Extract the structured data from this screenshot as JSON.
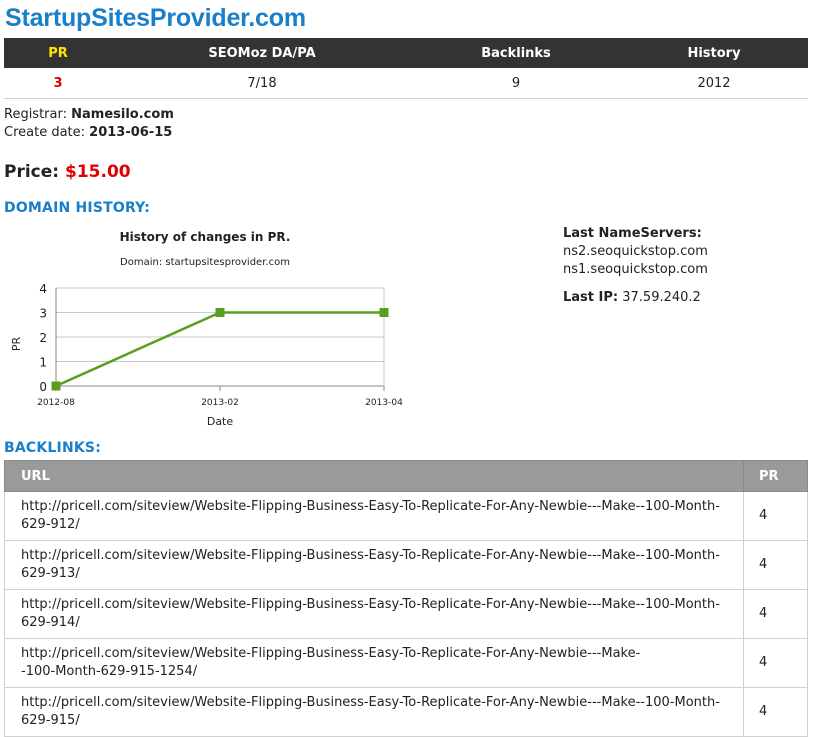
{
  "site": {
    "title": "StartupSitesProvider.com"
  },
  "summary": {
    "headers": [
      "PR",
      "SEOMoz DA/PA",
      "Backlinks",
      "History"
    ],
    "values": [
      "3",
      "7/18",
      "9",
      "2012"
    ]
  },
  "registrar": {
    "label": "Registrar:",
    "value": "Namesilo.com"
  },
  "create_date": {
    "label": "Create date:",
    "value": "2013-06-15"
  },
  "price": {
    "label": "Price:",
    "value": "$15.00"
  },
  "sections": {
    "history": "DOMAIN HISTORY:",
    "backlinks": "BACKLINKS:"
  },
  "chart_data": {
    "type": "line",
    "title": "History of changes in PR.",
    "subtitle": "Domain: startupsitesprovider.com",
    "xlabel": "Date",
    "ylabel": "PR",
    "x": [
      "2012-08",
      "2013-02",
      "2013-04"
    ],
    "series": [
      {
        "values": [
          0,
          3,
          3
        ]
      }
    ],
    "ylim": [
      0,
      4
    ],
    "yticks": [
      "0",
      "1",
      "2",
      "3",
      "4"
    ],
    "grid": true,
    "line_color": "#5a9e1e"
  },
  "dns": {
    "ns_label": "Last NameServers:",
    "nameservers": [
      "ns2.seoquickstop.com",
      "ns1.seoquickstop.com"
    ],
    "ip_label": "Last IP:",
    "ip": "37.59.240.2"
  },
  "backlinks": {
    "headers": {
      "url": "URL",
      "pr": "PR"
    },
    "rows": [
      {
        "url": "http://pricell.com/siteview/Website-Flipping-Business-Easy-To-Replicate-For-Any-Newbie---Make--100-Month-629-912/",
        "pr": "4"
      },
      {
        "url": "http://pricell.com/siteview/Website-Flipping-Business-Easy-To-Replicate-For-Any-Newbie---Make--100-Month-629-913/",
        "pr": "4"
      },
      {
        "url": "http://pricell.com/siteview/Website-Flipping-Business-Easy-To-Replicate-For-Any-Newbie---Make--100-Month-629-914/",
        "pr": "4"
      },
      {
        "url": "http://pricell.com/siteview/Website-Flipping-Business-Easy-To-Replicate-For-Any-Newbie---Make--100-Month-629-915-1254/",
        "pr": "4"
      },
      {
        "url": "http://pricell.com/siteview/Website-Flipping-Business-Easy-To-Replicate-For-Any-Newbie---Make--100-Month-629-915/",
        "pr": "4"
      }
    ]
  }
}
